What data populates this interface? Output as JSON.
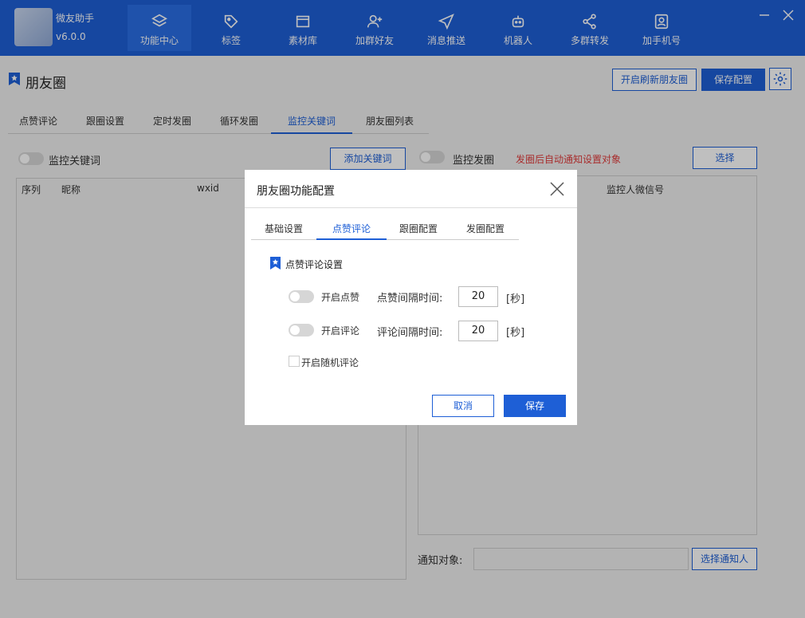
{
  "app": {
    "name": "微友助手",
    "version": "v6.0.0"
  },
  "nav": [
    {
      "label": "功能中心",
      "icon": "layers-icon",
      "active": true
    },
    {
      "label": "标签",
      "icon": "tag-icon"
    },
    {
      "label": "素材库",
      "icon": "folder-icon"
    },
    {
      "label": "加群好友",
      "icon": "add-user-icon"
    },
    {
      "label": "消息推送",
      "icon": "send-icon"
    },
    {
      "label": "机器人",
      "icon": "robot-icon"
    },
    {
      "label": "多群转发",
      "icon": "share-icon"
    },
    {
      "label": "加手机号",
      "icon": "contact-card-icon"
    }
  ],
  "page": {
    "title": "朋友圈",
    "refresh_btn": "开启刷新朋友圈",
    "save_btn": "保存配置"
  },
  "main_tabs": [
    "点赞评论",
    "跟圈设置",
    "定时发圈",
    "循环发圈",
    "监控关键词",
    "朋友圈列表"
  ],
  "active_main_tab": 4,
  "left_panel": {
    "toggle_label": "监控关键词",
    "add_btn": "添加关键词",
    "columns": [
      "序列",
      "昵称",
      "wxid"
    ]
  },
  "right_panel": {
    "toggle_label": "监控发圈",
    "hint": "发圈后自动通知设置对象",
    "select_btn": "选择",
    "column": "监控人微信号",
    "notify_label": "通知对象:",
    "notify_value": "",
    "notify_btn": "选择通知人"
  },
  "dialog": {
    "title": "朋友圈功能配置",
    "tabs": [
      "基础设置",
      "点赞评论",
      "跟圈配置",
      "发圈配置"
    ],
    "active_tab": 1,
    "section_title": "点赞评论设置",
    "like": {
      "label": "开启点赞",
      "interval_label": "点赞间隔时间:",
      "value": "20",
      "unit": "[秒]"
    },
    "comment": {
      "label": "开启评论",
      "interval_label": "评论间隔时间:",
      "value": "20",
      "unit": "[秒]"
    },
    "random_comment": "开启随机评论",
    "cancel": "取消",
    "save": "保存"
  },
  "colors": {
    "primary": "#1e5fd6",
    "hint_red": "#e03c3c"
  }
}
